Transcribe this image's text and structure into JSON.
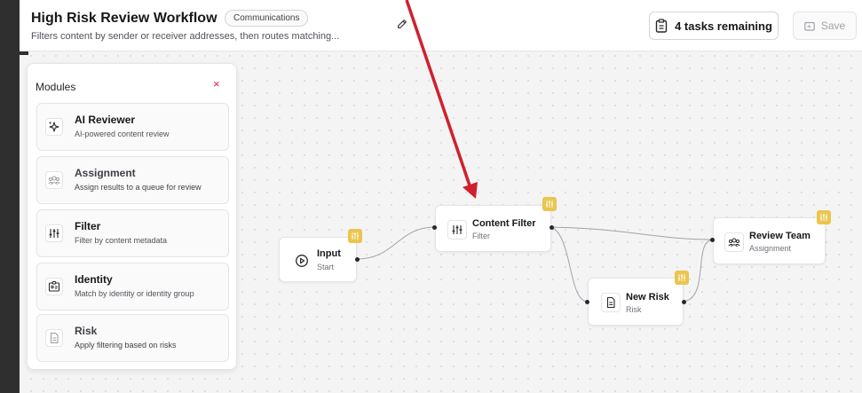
{
  "header": {
    "title": "High Risk Review Workflow",
    "badge": "Communications",
    "description": "Filters content by sender or receiver addresses, then routes matching...",
    "tasks_label": "4 tasks remaining",
    "save_label": "Save"
  },
  "modules": {
    "title": "Modules",
    "close": "×",
    "items": [
      {
        "name": "AI Reviewer",
        "desc": "AI-powered content review",
        "icon": "sparkle-icon"
      },
      {
        "name": "Assignment",
        "desc": "Assign results to a queue for review",
        "icon": "users-icon"
      },
      {
        "name": "Filter",
        "desc": "Filter by content metadata",
        "icon": "sliders-icon"
      },
      {
        "name": "Identity",
        "desc": "Match by identity or identity group",
        "icon": "id-card-icon"
      },
      {
        "name": "Risk",
        "desc": "Apply filtering based on risks",
        "icon": "document-icon"
      }
    ]
  },
  "canvas": {
    "nodes": [
      {
        "id": "input",
        "title": "Input",
        "sub": "Start",
        "icon": "play-circle-icon"
      },
      {
        "id": "content-filter",
        "title": "Content Filter",
        "sub": "Filter",
        "icon": "sliders-icon"
      },
      {
        "id": "new-risk",
        "title": "New Risk",
        "sub": "Risk",
        "icon": "document-icon"
      },
      {
        "id": "review-team",
        "title": "Review Team",
        "sub": "Assignment",
        "icon": "users-icon"
      }
    ],
    "badge_icon": "sliders-icon",
    "badge_color": "#eac54f",
    "annotation_color": "#d0202e"
  }
}
